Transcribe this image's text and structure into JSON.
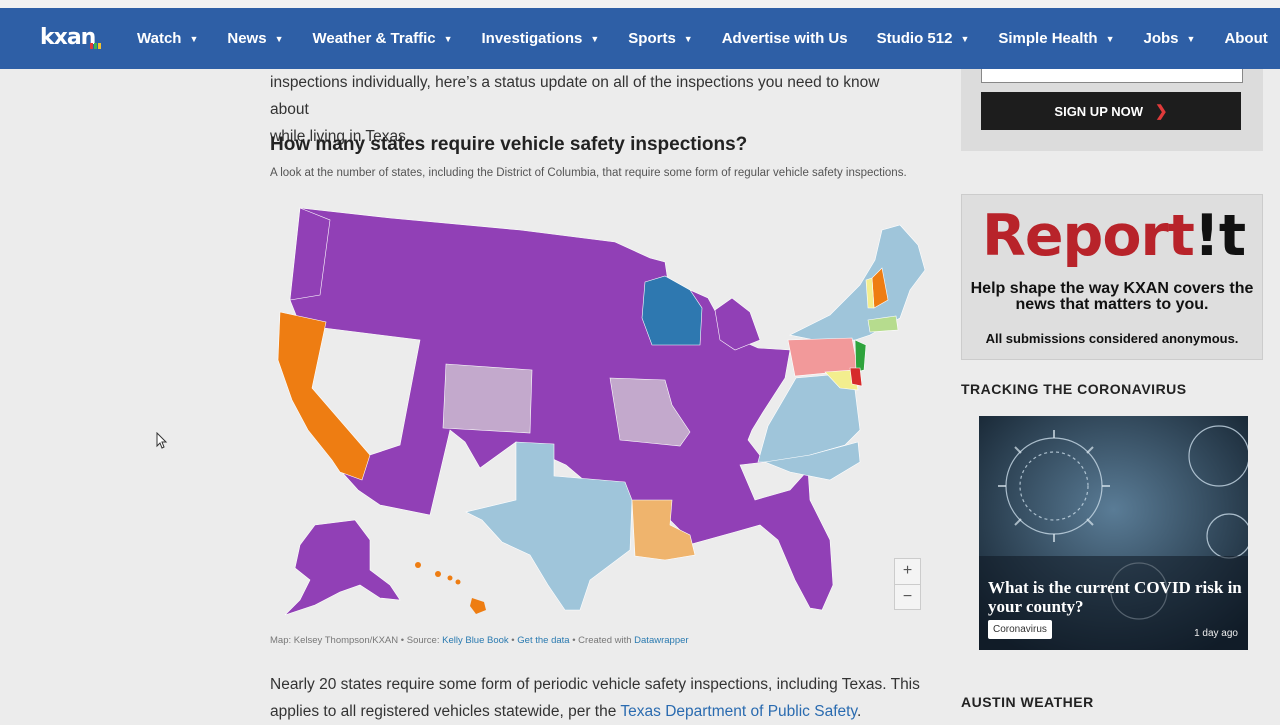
{
  "nav": {
    "logo": "kxan",
    "items": [
      {
        "label": "Watch",
        "caret": true
      },
      {
        "label": "News",
        "caret": true
      },
      {
        "label": "Weather & Traffic",
        "caret": true
      },
      {
        "label": "Investigations",
        "caret": true
      },
      {
        "label": "Sports",
        "caret": true
      },
      {
        "label": "Advertise with Us",
        "caret": false
      },
      {
        "label": "Studio 512",
        "caret": true
      },
      {
        "label": "Simple Health",
        "caret": true
      },
      {
        "label": "Jobs",
        "caret": true
      },
      {
        "label": "About",
        "caret": false
      }
    ]
  },
  "article": {
    "intro_line1": "inspections individually, here’s a status update on all of the inspections you need to know about",
    "intro_line2": "while living in Texas.",
    "heading": "How many states require vehicle safety inspections?",
    "map_subtitle": "A look at the number of states, including the District of Columbia, that require some form of regular vehicle safety inspections.",
    "credit_prefix": "Map: Kelsey Thompson/KXAN • Source: ",
    "credit_source": "Kelly Blue Book",
    "credit_sep": " • ",
    "credit_data": "Get the data",
    "credit_created": " • Created with ",
    "credit_tool": "Datawrapper",
    "body_line1": "Nearly 20 states require some form of periodic vehicle safety inspections, including Texas. This",
    "body_line2_prefix": "applies to all registered vehicles statewide, per the ",
    "body_link": "Texas Department of Public Safety",
    "body_line2_suffix": "."
  },
  "map_colors": {
    "purple": "#9140b6",
    "light_blue": "#9fc5da",
    "orange": "#ee7d12",
    "light_orange": "#efb46d",
    "dark_blue": "#2e78b0",
    "lavender": "#c3a9cc",
    "pink": "#f2999a",
    "green": "#2ea33c",
    "light_green": "#b6dc8e",
    "red": "#d62b2b",
    "yellow": "#f3ee8e"
  },
  "zoom": {
    "plus": "+",
    "minus": "−"
  },
  "sidebar": {
    "signup_label": "SIGN UP NOW",
    "report_title_a": "Report",
    "report_title_b": "!t",
    "report_tagline": "Help shape the way KXAN covers the news that matters to you.",
    "report_note": "All submissions considered anonymous.",
    "tracking_heading": "TRACKING THE CORONAVIRUS",
    "covid_title": "What is the current COVID risk in your county?",
    "covid_tag": "Coronavirus",
    "covid_time": "1 day ago",
    "weather_heading": "AUSTIN WEATHER"
  }
}
